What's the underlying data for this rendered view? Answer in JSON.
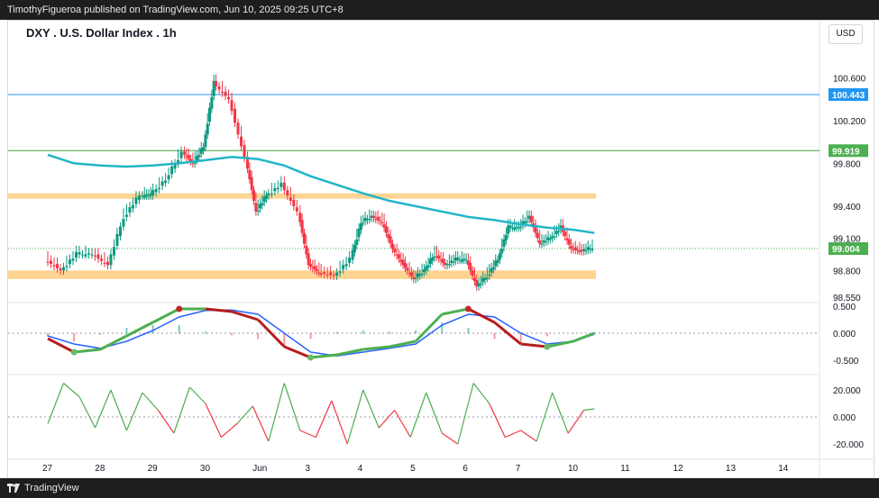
{
  "header": {
    "text": "TimothyFigueroa published on TradingView.com, Jun 10, 2025 09:25 UTC+8"
  },
  "footer": {
    "brand": "TradingView"
  },
  "chart": {
    "symbol": "DXY . U.S. Dollar Index . 1h",
    "currency": "USD"
  },
  "colors": {
    "ma": "#22b5c8",
    "zone": "#ffcc80",
    "blue_line": "#2196f3",
    "green_line": "#43a047",
    "last_price": "#2196f3",
    "green_price": "#4caf50",
    "up": "#089981",
    "down": "#f23645"
  },
  "chart_data": [
    {
      "type": "line",
      "title": "DXY . U.S. Dollar Index . 1h",
      "x_ticks": [
        "27",
        "28",
        "29",
        "30",
        "Jun",
        "3",
        "4",
        "5",
        "6",
        "7",
        "10",
        "11",
        "12",
        "13",
        "14"
      ],
      "y_ticks": [
        "100.600",
        "100.200",
        "99.800",
        "99.400",
        "99.100",
        "98.800",
        "98.550"
      ],
      "price_labels": [
        {
          "value": 100.443,
          "label": "100.443",
          "kind": "blue-line"
        },
        {
          "value": 99.919,
          "label": "99.919",
          "kind": "green-line"
        },
        {
          "value": 99.004,
          "label": "99.004",
          "kind": "last-price"
        }
      ],
      "zones": [
        [
          99.47,
          99.52
        ],
        [
          98.72,
          98.8
        ]
      ],
      "series": [
        {
          "kind": "price",
          "x": [
            0,
            0.3,
            0.6,
            0.9,
            1.2,
            1.5,
            1.8,
            2.0,
            2.3,
            2.6,
            2.8,
            3.0,
            3.2,
            3.5,
            3.8,
            4.0,
            4.2,
            4.5,
            4.8,
            5.0,
            5.2,
            5.5,
            5.8,
            6.0,
            6.2,
            6.4,
            6.6,
            6.8,
            7.0,
            7.2,
            7.4,
            7.6,
            7.8,
            8.0,
            8.2,
            8.4,
            8.6,
            8.8,
            9.0,
            9.2,
            9.4,
            9.6,
            9.8,
            10.0,
            10.2,
            10.4
          ],
          "values": [
            98.9,
            98.8,
            98.95,
            98.95,
            98.85,
            99.3,
            99.5,
            99.5,
            99.65,
            99.9,
            99.8,
            99.95,
            100.55,
            100.4,
            99.85,
            99.35,
            99.5,
            99.6,
            99.35,
            98.85,
            98.78,
            98.75,
            98.9,
            99.25,
            99.3,
            99.25,
            99.0,
            98.85,
            98.72,
            98.8,
            98.95,
            98.85,
            98.9,
            98.9,
            98.65,
            98.75,
            98.9,
            99.2,
            99.2,
            99.3,
            99.05,
            99.1,
            99.2,
            99.0,
            98.98,
            99.01
          ]
        },
        {
          "kind": "moving-average",
          "x": [
            0,
            0.5,
            1.0,
            1.5,
            2.0,
            2.5,
            3.0,
            3.5,
            4.0,
            4.5,
            5.0,
            5.5,
            6.0,
            6.5,
            7.0,
            7.5,
            8.0,
            8.5,
            9.0,
            9.5,
            10.0,
            10.4
          ],
          "values": [
            99.88,
            99.8,
            99.78,
            99.77,
            99.78,
            99.8,
            99.83,
            99.86,
            99.84,
            99.78,
            99.68,
            99.6,
            99.52,
            99.45,
            99.4,
            99.35,
            99.3,
            99.27,
            99.23,
            99.2,
            99.18,
            99.15
          ]
        }
      ]
    },
    {
      "type": "line",
      "y_ticks": [
        "0.500",
        "0.000",
        "-0.500"
      ],
      "series": [
        {
          "x": [
            0,
            0.5,
            1,
            1.5,
            2,
            2.5,
            3,
            3.5,
            4,
            4.5,
            5,
            5.5,
            6,
            6.5,
            7,
            7.5,
            8,
            8.5,
            9,
            9.5,
            10,
            10.4
          ],
          "values": [
            -0.1,
            -0.35,
            -0.3,
            -0.05,
            0.2,
            0.45,
            0.45,
            0.4,
            0.25,
            -0.25,
            -0.45,
            -0.4,
            -0.3,
            -0.25,
            -0.15,
            0.35,
            0.45,
            0.2,
            -0.2,
            -0.25,
            -0.15,
            0.0
          ]
        },
        {
          "x": [
            0,
            0.5,
            1,
            1.5,
            2,
            2.5,
            3,
            3.5,
            4,
            4.5,
            5,
            5.5,
            6,
            6.5,
            7,
            7.5,
            8,
            8.5,
            9,
            9.5,
            10,
            10.4
          ],
          "values": [
            -0.05,
            -0.2,
            -0.28,
            -0.15,
            0.05,
            0.3,
            0.42,
            0.43,
            0.35,
            0.0,
            -0.35,
            -0.42,
            -0.35,
            -0.28,
            -0.2,
            0.15,
            0.35,
            0.3,
            0.0,
            -0.2,
            -0.15,
            -0.02
          ]
        }
      ]
    },
    {
      "type": "line",
      "y_ticks": [
        "20.000",
        "0.000",
        "-20.000"
      ],
      "series": [
        {
          "x": [
            0,
            0.3,
            0.6,
            0.9,
            1.2,
            1.5,
            1.8,
            2.1,
            2.4,
            2.7,
            3.0,
            3.3,
            3.6,
            3.9,
            4.2,
            4.5,
            4.8,
            5.1,
            5.4,
            5.7,
            6.0,
            6.3,
            6.6,
            6.9,
            7.2,
            7.5,
            7.8,
            8.1,
            8.4,
            8.7,
            9.0,
            9.3,
            9.6,
            9.9,
            10.2,
            10.4
          ],
          "values": [
            -5,
            25,
            15,
            -8,
            20,
            -10,
            18,
            5,
            -12,
            22,
            10,
            -15,
            -5,
            8,
            -18,
            25,
            -10,
            -15,
            12,
            -20,
            20,
            -8,
            5,
            -15,
            18,
            -12,
            -20,
            25,
            10,
            -15,
            -10,
            -18,
            18,
            -12,
            5,
            6
          ]
        }
      ]
    }
  ]
}
